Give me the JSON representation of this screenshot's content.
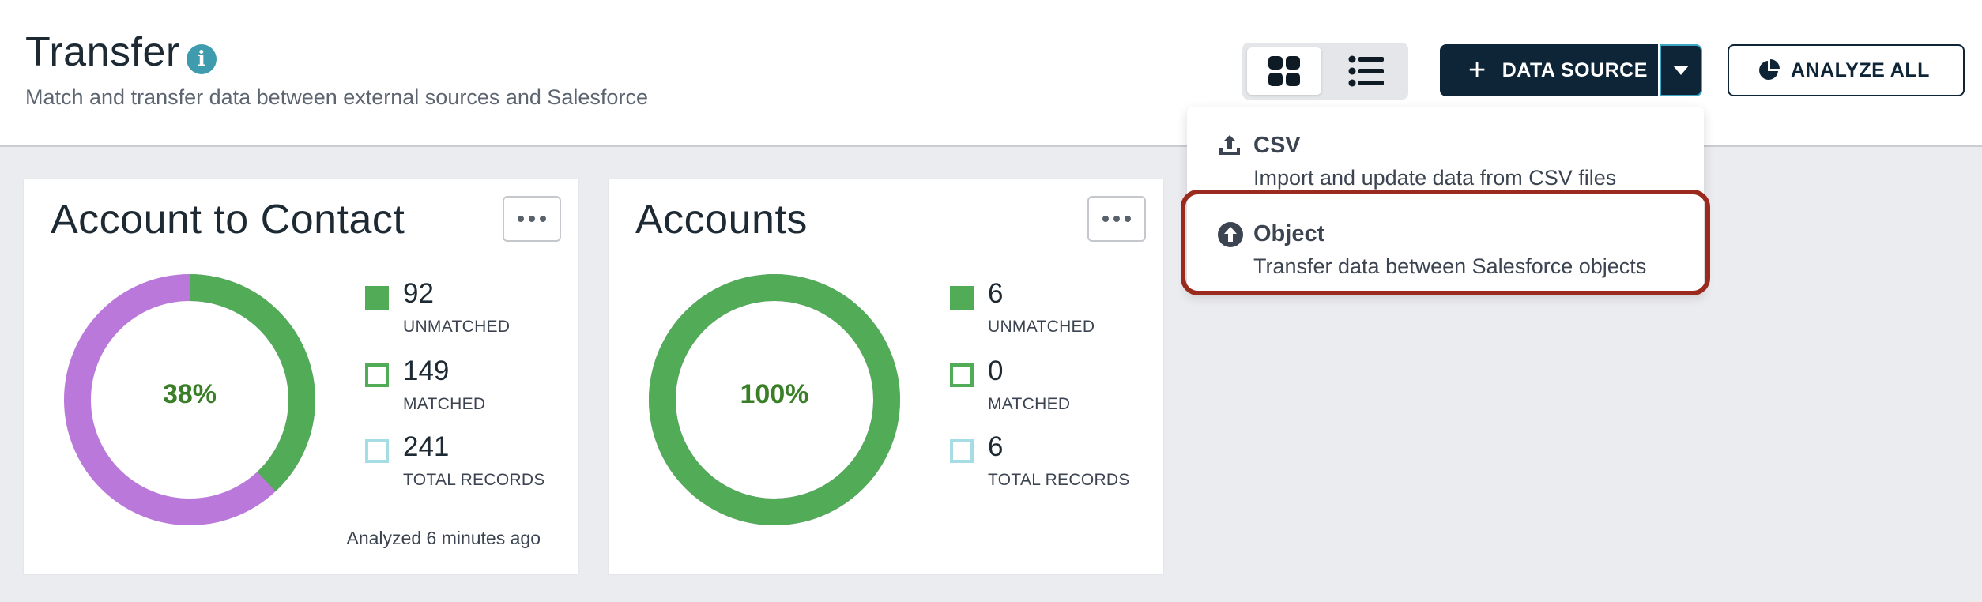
{
  "header": {
    "title": "Transfer",
    "subtitle": "Match and transfer data between external sources and Salesforce"
  },
  "toolbar": {
    "view_modes": [
      "grid-view-icon",
      "list-view-icon"
    ],
    "active_view": "grid",
    "data_source_label": "DATA SOURCE",
    "analyze_all_label": "ANALYZE ALL"
  },
  "dropdown": {
    "items": [
      {
        "label": "CSV",
        "description": "Import and update data from CSV files",
        "icon": "upload-icon"
      },
      {
        "label": "Object",
        "description": "Transfer data between Salesforce objects",
        "icon": "arrow-up-circle-icon",
        "highlighted": true
      }
    ]
  },
  "cards": [
    {
      "title": "Account to Contact",
      "percent_label": "38%",
      "percent": 38,
      "unmatched": "92",
      "unmatched_label": "UNMATCHED",
      "matched": "149",
      "matched_label": "MATCHED",
      "total": "241",
      "total_label": "TOTAL RECORDS",
      "analyzed": "Analyzed 6 minutes ago"
    },
    {
      "title": "Accounts",
      "percent_label": "100%",
      "percent": 100,
      "unmatched": "6",
      "unmatched_label": "UNMATCHED",
      "matched": "0",
      "matched_label": "MATCHED",
      "total": "6",
      "total_label": "TOTAL RECORDS"
    }
  ],
  "colors": {
    "primary_button": "#0e2437",
    "unmatched": "#52ac57",
    "matched_remainder": "#ba78db",
    "total": "#a6dde4",
    "highlight": "#9b2a1e",
    "info": "#3e9cae"
  }
}
